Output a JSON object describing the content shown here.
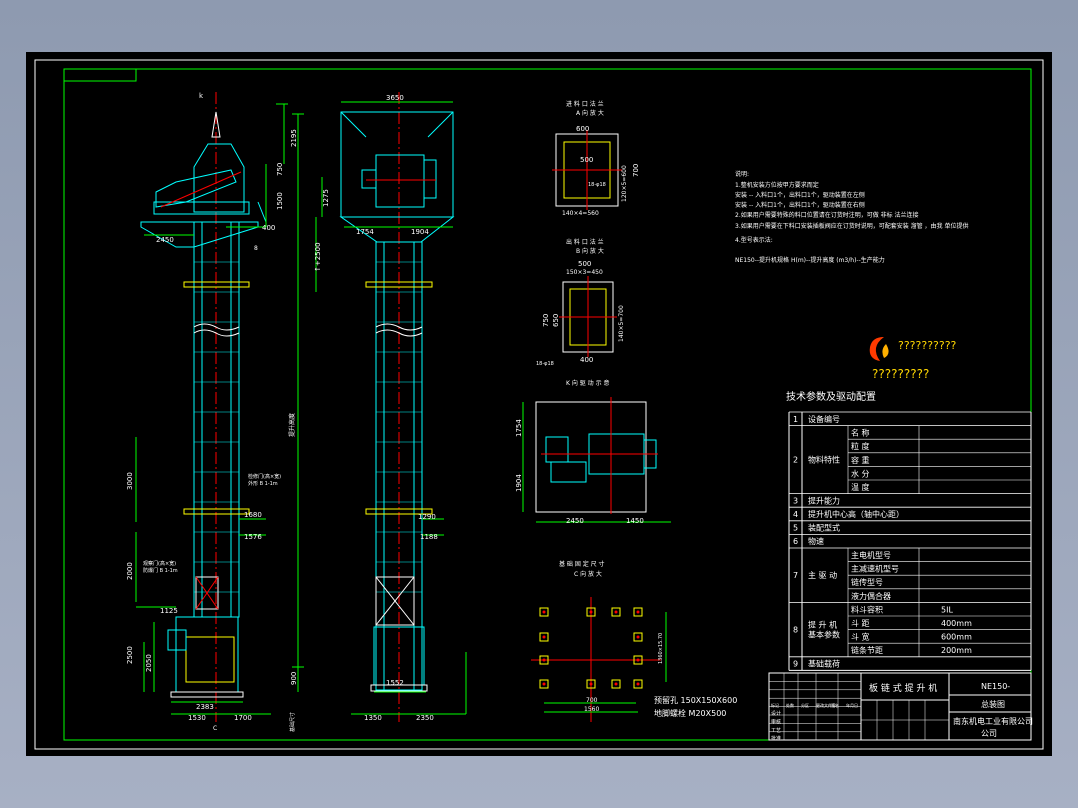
{
  "colors": {
    "frame": "#ffffff",
    "border": "#00ff00",
    "lines": "#00ffff",
    "dims": "#00ff00",
    "center": "#ff0000",
    "text": "#ffffff",
    "steel": "#ffff00"
  },
  "view1": {
    "section_mark": "k",
    "dim_2195": "2195",
    "dim_750": "750",
    "dim_1500": "1500",
    "dim_400": "400",
    "dim_2450": "2450",
    "dim_8": "8",
    "total_label": "提升高度",
    "note_line1": "检修门(高×宽)",
    "note_line2": "外形 B 1-1m",
    "dim_1680": "1680",
    "dim_1576": "1576",
    "dim_3000": "3000",
    "dim_2000": "2000",
    "dim_1125": "1125",
    "door_note1": "观察门(高×宽)",
    "door_note2": "防爆门 B 1-1m",
    "dim_2500": "2500",
    "dim_2050": "2050",
    "dim_900": "900",
    "dim_2383": "2383",
    "dim_1530": "1530",
    "dim_1700": "1700",
    "dim_c": "C",
    "base_label": "基础尺寸"
  },
  "view2": {
    "dim_3650": "3650",
    "dim_1275": "1275",
    "dim_h2500": "↑+2500",
    "dim_1754": "1754",
    "dim_1904": "1904",
    "dim_1290": "1290",
    "dim_1188": "1188",
    "dim_1552": "1552",
    "dim_1350": "1350",
    "dim_2350": "2350"
  },
  "detail_a": {
    "title": "进 料 口 法 兰",
    "subtitle": "A 向 放 大",
    "dim_600": "600",
    "dim_500": "500",
    "dim_v": "120×5=600",
    "dim_700": "700",
    "dim_h": "140×4=560",
    "hole": "18-φ18"
  },
  "detail_b": {
    "title": "出 料 口 法 兰",
    "subtitle": "B 向 放 大",
    "dim_500": "500",
    "dim_h": "150×3=450",
    "dim_750": "750",
    "dim_650": "650",
    "dim_v": "140×5=700",
    "dim_400": "400",
    "hole": "18-φ18"
  },
  "detail_k": {
    "title": "K 向 驱 动 示 意",
    "dim_1754": "1754",
    "dim_1904": "1904",
    "dim_2450": "2450",
    "dim_1450": "1450"
  },
  "detail_c": {
    "title": "基 础 固 定 尺 寸",
    "subtitle": "C 向 放 大",
    "dim_700": "700",
    "dim_1560": "1560",
    "dim_v": "1360×15.70",
    "anchor1": "预留孔  150X150X600",
    "anchor2": "地脚螺栓  M20X500"
  },
  "notes": {
    "heading": "说明:",
    "l1": "1.整机安装方位按甲方要求而定",
    "l2": "   安装  --  入料口1个，出料口1个，驱动装置在左侧",
    "l3": "   安装  --  入料口1个，出料口1个，驱动装置在右侧",
    "l4": "2.如果用户需要特殊的料口位置请在订货时注明，可做 非标 法兰连接",
    "l5": "3.如果用户需要在下料口安装插板阀应在订货时说明，可配套安装 溜管 ，由我 单位提供",
    "l6": "4.型号表示法:",
    "l7": "   NE150--提升机规格  H(m)--提升高度  (m3/h)--生产能力"
  },
  "logo": {
    "line1": "??????????",
    "line2": "?????????"
  },
  "param_table": {
    "title": "技术参数及驱动配置",
    "rows": [
      {
        "no": "1",
        "name": "设备编号"
      },
      {
        "no": "2",
        "name": "物料特性",
        "subs": [
          "名    称",
          "粒    度",
          "容    重",
          "水    分",
          "温    度"
        ]
      },
      {
        "no": "3",
        "name": "提升能力"
      },
      {
        "no": "4",
        "name": "提升机中心高（轴中心距）"
      },
      {
        "no": "5",
        "name": "装配型式"
      },
      {
        "no": "6",
        "name": "物速"
      },
      {
        "no": "7",
        "name": "主 驱 动",
        "subs": [
          "主电机型号",
          "主减速机型号",
          "链传型号",
          "液力偶合器"
        ]
      },
      {
        "no": "8",
        "name": "提 升 机\n基本参数",
        "subs": [
          "料斗容积",
          "斗    距",
          "斗    宽",
          "链条节距"
        ],
        "vals": [
          "5IL",
          "400mm",
          "600mm",
          "200mm"
        ]
      },
      {
        "no": "9",
        "name": "基础载荷"
      }
    ]
  },
  "title_block": {
    "drawing_title": "板 链 式 提 升 机",
    "model": "NE150-",
    "drawing_type": "总装图",
    "company": "南东机电工业有限公司",
    "small_rows": [
      "标记",
      "处数",
      "分区",
      "更改文件号",
      "签名",
      "年月日"
    ],
    "role_rows": [
      "设计",
      "审核",
      "工艺",
      "批准"
    ]
  }
}
